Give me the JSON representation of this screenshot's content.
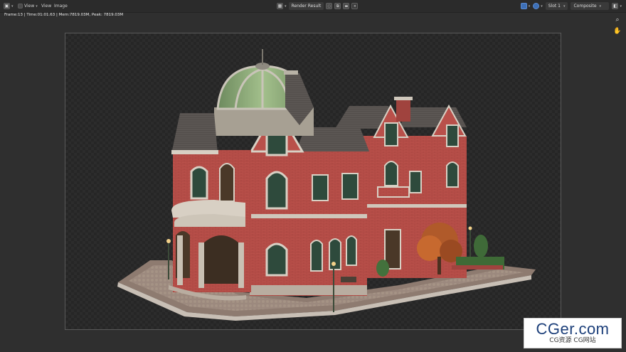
{
  "header": {
    "editor_type_icon": "image-editor-icon",
    "menu": [
      "View",
      "View",
      "Image"
    ],
    "image_name": "Render Result",
    "slot": "Slot 1",
    "pass": "Composite"
  },
  "info": {
    "text": "Frame:13 | Time:01:01.63 | Mem:7819.03M, Peak: 7819.03M"
  },
  "tools": [
    "zoom-icon",
    "hand-pan-icon"
  ],
  "watermark": {
    "main": "CGer.com",
    "sub": "CG资源 CG网站"
  },
  "colors": {
    "background": "#2f2f2f",
    "header": "#2b2b2b",
    "brick": "#b9504a",
    "dome": "#8fae7a",
    "roof": "#5a5552"
  }
}
